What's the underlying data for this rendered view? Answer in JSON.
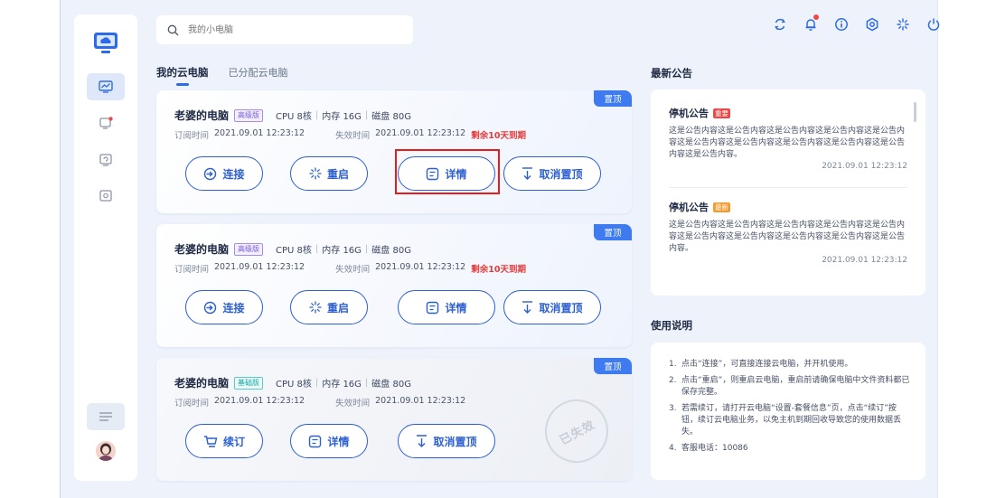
{
  "search": {
    "placeholder": "我的小电脑"
  },
  "tabs": [
    {
      "label": "我的云电脑",
      "active": true
    },
    {
      "label": "已分配云电脑",
      "active": false
    }
  ],
  "top_icons": [
    "refresh-icon",
    "bell-icon",
    "info-icon",
    "settings-icon",
    "brightness-icon",
    "power-icon"
  ],
  "cards": [
    {
      "name": "老婆的电脑",
      "tier": "高级版",
      "cpu": "CPU 8核",
      "memory": "内存 16G",
      "disk": "磁盘 80G",
      "subscribe_label": "订阅时间",
      "subscribe_time": "2021.09.01 12:23:12",
      "expire_label": "失效时间",
      "expire_time": "2021.09.01 12:23:12",
      "warning": "剩余10天到期",
      "pin_tag": "置顶",
      "buttons": {
        "connect": "连接",
        "restart": "重启",
        "details": "详情",
        "unpin": "取消置顶"
      }
    },
    {
      "name": "老婆的电脑",
      "tier": "高级版",
      "cpu": "CPU 8核",
      "memory": "内存 16G",
      "disk": "磁盘 80G",
      "subscribe_label": "订阅时间",
      "subscribe_time": "2021.09.01 12:23:12",
      "expire_label": "失效时间",
      "expire_time": "2021.09.01 12:23:12",
      "warning": "剩余10天到期",
      "pin_tag": "置顶",
      "buttons": {
        "connect": "连接",
        "restart": "重启",
        "details": "详情",
        "unpin": "取消置顶"
      }
    },
    {
      "name": "老婆的电脑",
      "tier": "基础版",
      "cpu": "CPU 8核",
      "memory": "内存 16G",
      "disk": "磁盘 80G",
      "subscribe_label": "订阅时间",
      "subscribe_time": "2021.09.01 12:23:12",
      "expire_label": "失效时间",
      "expire_time": "2021.09.01 12:23:12",
      "pin_tag": "置顶",
      "stamp": "已失效",
      "buttons": {
        "renew": "续订",
        "details": "详情",
        "unpin": "取消置顶"
      }
    }
  ],
  "announcements": {
    "title": "最新公告",
    "items": [
      {
        "title": "停机公告",
        "tag": "重要",
        "tag_color": "#ef4444",
        "body": "这是公告内容这是公告内容这是公告内容这是公告内容这是公告内容这是公告内容这是公告内容这是公告内容这是公告内容这是公告内容这是公告内容。",
        "time": "2021.09.01 12:23:12"
      },
      {
        "title": "停机公告",
        "tag": "最新",
        "tag_color": "#f59b2e",
        "body": "这是公告内容这是公告内容这是公告内容这是公告内容这是公告内容这是公告内容这是公告内容这是公告内容这是公告内容这是公告内容。",
        "time": "2021.09.01 12:23:12"
      }
    ]
  },
  "guide": {
    "title": "使用说明",
    "items": [
      {
        "num": "1.",
        "text": "点击“连接”，可直接连接云电脑，并开机使用。"
      },
      {
        "num": "2.",
        "text": "点击“重启”，则重启云电脑，重启前请确保电脑中文件资料都已保存完整。"
      },
      {
        "num": "3.",
        "text": "若需续订，请打开云电脑“设置-套餐信息”页，点击“续订”按钮，续订云电脑业务，以免主机到期回收导致您的使用数据丢失。"
      },
      {
        "num": "4.",
        "text": "客服电话：10086"
      }
    ]
  },
  "colors": {
    "accent": "#2c5fd0",
    "pin": "#3e7bf1",
    "warning": "#e33c3c",
    "highlight": "#e81c1c"
  }
}
